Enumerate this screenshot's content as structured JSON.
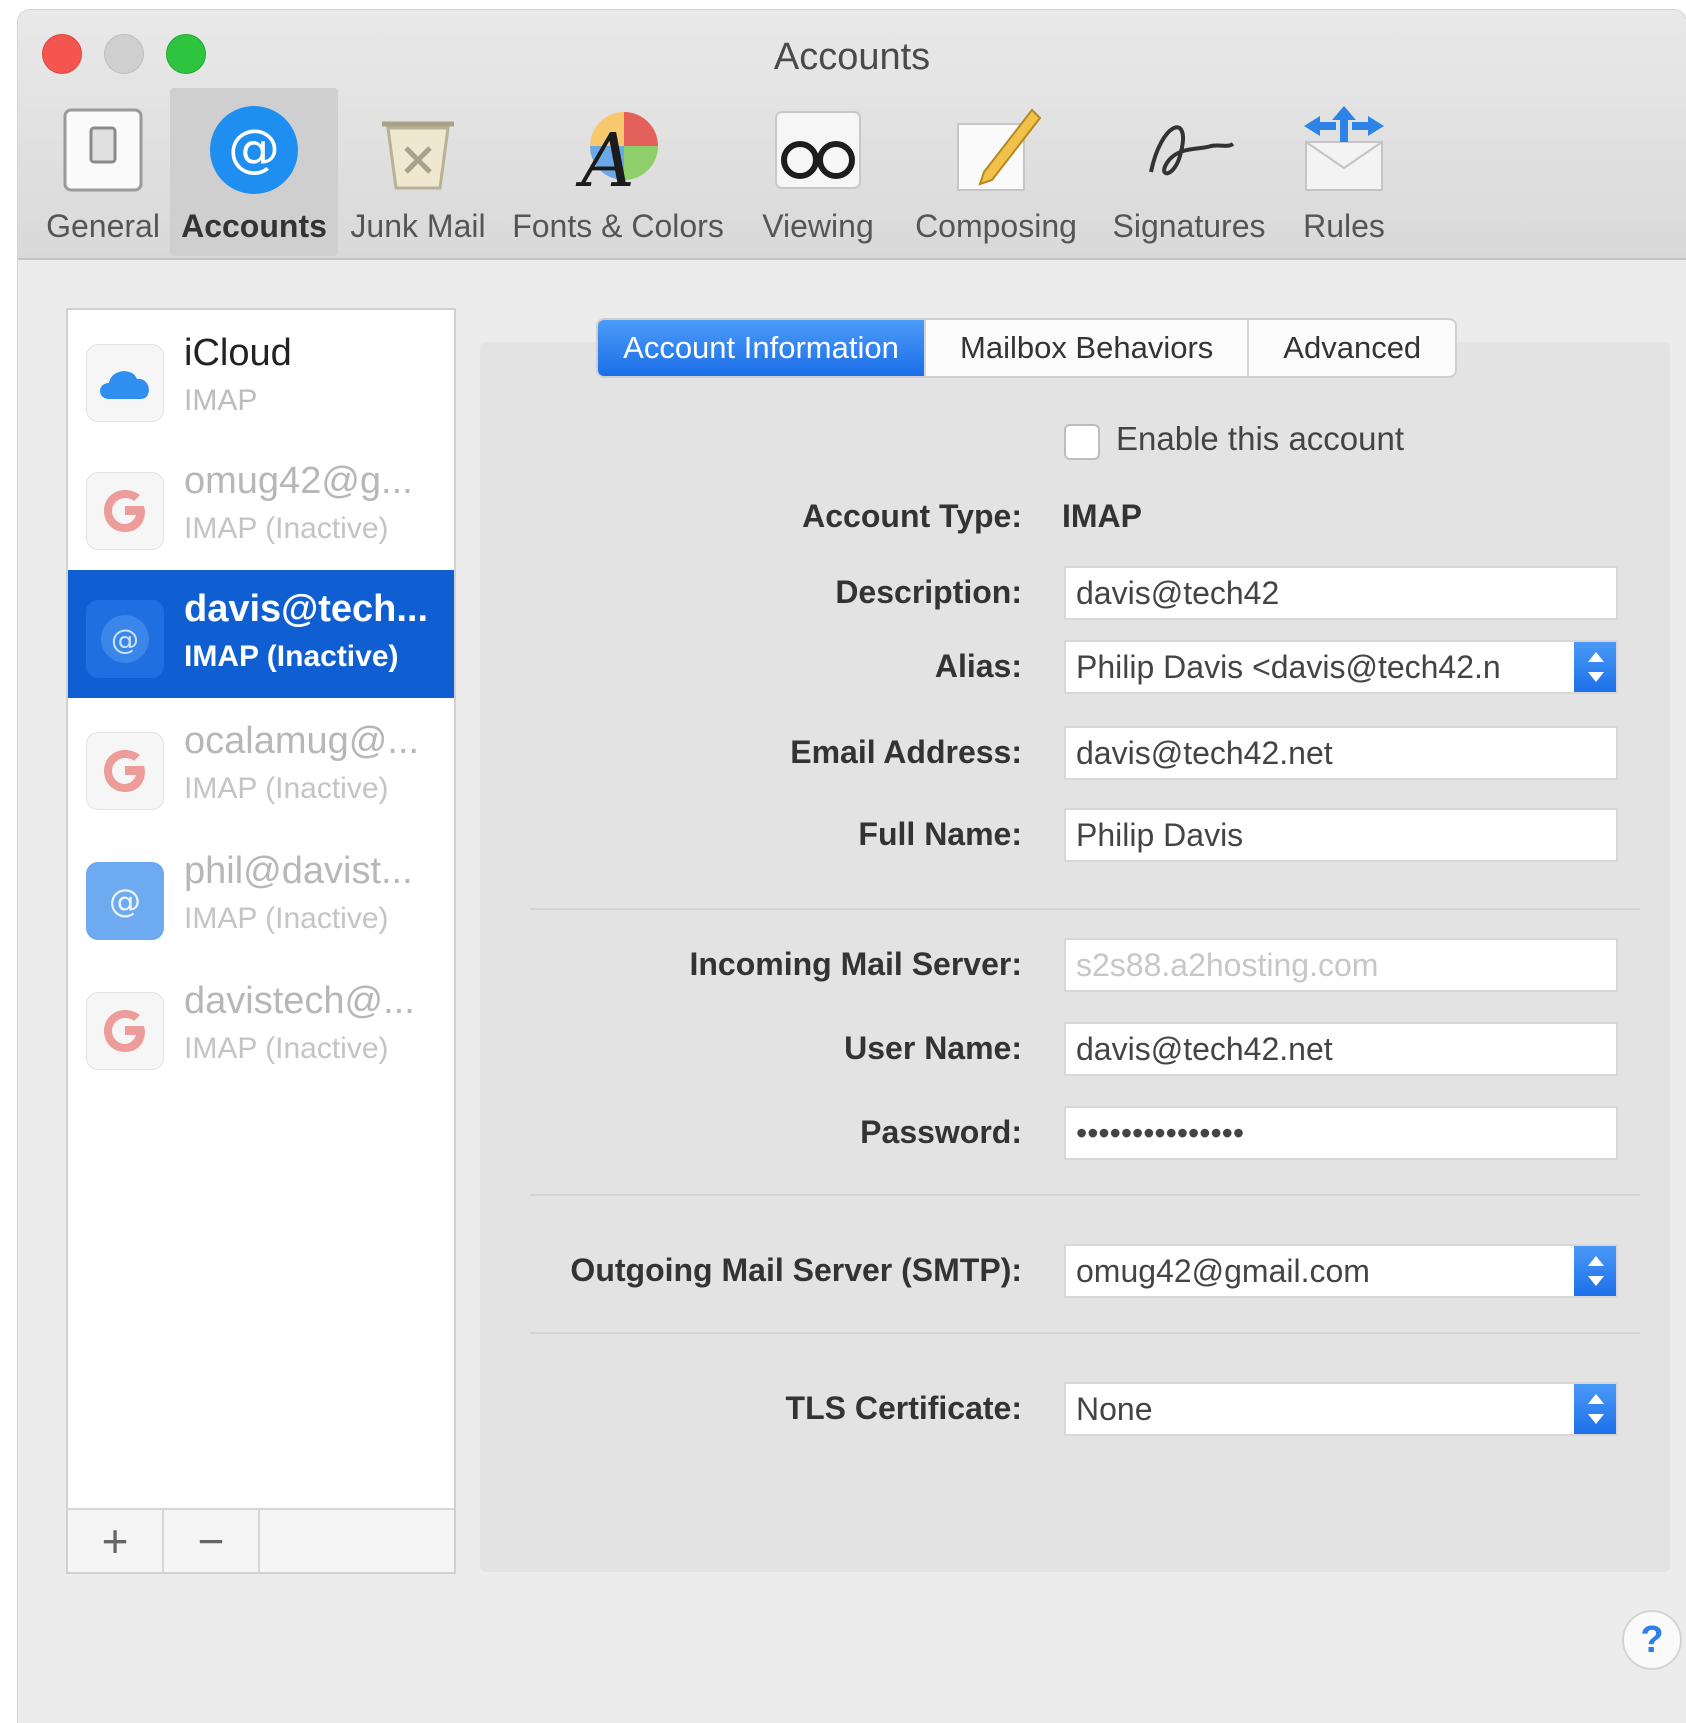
{
  "window": {
    "title": "Accounts"
  },
  "toolbar": {
    "items": [
      {
        "label": "General",
        "icon": "general-switch-icon"
      },
      {
        "label": "Accounts",
        "icon": "at-sign-icon"
      },
      {
        "label": "Junk Mail",
        "icon": "junk-bin-icon"
      },
      {
        "label": "Fonts & Colors",
        "icon": "font-color-wheel-icon"
      },
      {
        "label": "Viewing",
        "icon": "glasses-icon"
      },
      {
        "label": "Composing",
        "icon": "pencil-note-icon"
      },
      {
        "label": "Signatures",
        "icon": "signature-icon"
      },
      {
        "label": "Rules",
        "icon": "rules-envelope-icon"
      }
    ],
    "active_index": 1
  },
  "accounts": [
    {
      "name": "iCloud",
      "type": "IMAP",
      "icon": "icloud-icon"
    },
    {
      "name": "omug42@g...",
      "type": "IMAP (Inactive)",
      "icon": "google-icon"
    },
    {
      "name": "davis@tech...",
      "type": "IMAP (Inactive)",
      "icon": "at-sign-icon"
    },
    {
      "name": "ocalamug@...",
      "type": "IMAP (Inactive)",
      "icon": "google-icon"
    },
    {
      "name": "phil@davist...",
      "type": "IMAP (Inactive)",
      "icon": "at-sign-icon"
    },
    {
      "name": "davistech@...",
      "type": "IMAP (Inactive)",
      "icon": "google-icon"
    }
  ],
  "sidebar_buttons": {
    "add": "+",
    "remove": "−"
  },
  "tabs": [
    "Account Information",
    "Mailbox Behaviors",
    "Advanced"
  ],
  "form": {
    "enable_label": "Enable this account",
    "enable_checked": false,
    "account_type_label": "Account Type:",
    "account_type": "IMAP",
    "description_label": "Description:",
    "description": "davis@tech42",
    "alias_label": "Alias:",
    "alias": "Philip Davis <davis@tech42.n",
    "email_label": "Email Address:",
    "email": "davis@tech42.net",
    "fullname_label": "Full Name:",
    "fullname": "Philip Davis",
    "incoming_label": "Incoming Mail Server:",
    "incoming": "s2s88.a2hosting.com",
    "username_label": "User Name:",
    "username": "davis@tech42.net",
    "password_label": "Password:",
    "password": "•••••••••••••••",
    "smtp_label": "Outgoing Mail Server (SMTP):",
    "smtp": "omug42@gmail.com",
    "tls_label": "TLS Certificate:",
    "tls": "None"
  },
  "help": "?",
  "colors": {
    "accent": "#1b6ee8",
    "selection": "#0f5fd3",
    "close": "#f5554f",
    "zoom": "#2ec440"
  }
}
